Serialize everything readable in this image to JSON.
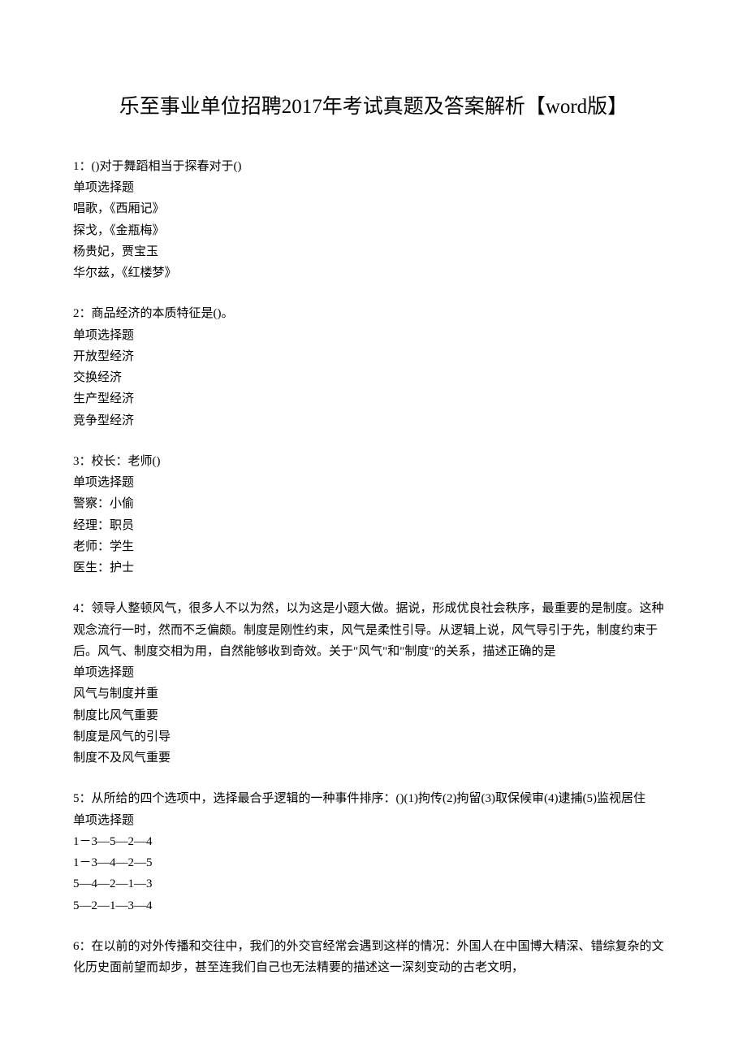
{
  "title": "乐至事业单位招聘2017年考试真题及答案解析【word版】",
  "questions": [
    {
      "num": "1：",
      "stem": "()对于舞蹈相当于探春对于()",
      "type": "单项选择题",
      "options": [
        "唱歌，《西厢记》",
        "探戈，《金瓶梅》",
        "杨贵妃，贾宝玉",
        "华尔兹，《红楼梦》"
      ]
    },
    {
      "num": "2：",
      "stem": "商品经济的本质特征是()。",
      "type": "单项选择题",
      "options": [
        "开放型经济",
        "交换经济",
        "生产型经济",
        "竞争型经济"
      ]
    },
    {
      "num": "3：",
      "stem": "校长：老师()",
      "type": "单项选择题",
      "options": [
        "警察：小偷",
        "经理：职员",
        "老师：学生",
        "医生：护士"
      ]
    },
    {
      "num": "4：",
      "stem": "领导人整顿风气，很多人不以为然，以为这是小题大做。据说，形成优良社会秩序，最重要的是制度。这种观念流行一时，然而不乏偏颇。制度是刚性约束，风气是柔性引导。从逻辑上说，风气导引于先，制度约束于后。风气、制度交相为用，自然能够收到奇效。关于\"风气\"和\"制度\"的关系，描述正确的是",
      "type": "单项选择题",
      "options": [
        "风气与制度并重",
        "制度比风气重要",
        "制度是风气的引导",
        "制度不及风气重要"
      ]
    },
    {
      "num": "5：",
      "stem": "从所给的四个选项中，选择最合乎逻辑的一种事件排序：()(1)拘传(2)拘留(3)取保候审(4)逮捕(5)监视居住",
      "type": "单项选择题",
      "options": [
        "1－3—5—2—4",
        "1－3—4—2—5",
        "5—4—2—1—3",
        "5—2—1—3—4"
      ]
    },
    {
      "num": "6：",
      "stem": "在以前的对外传播和交往中，我们的外交官经常会遇到这样的情况：外国人在中国博大精深、错综复杂的文化历史面前望而却步，甚至连我们自己也无法精要的描述这一深刻变动的古老文明，",
      "type": "",
      "options": []
    }
  ]
}
